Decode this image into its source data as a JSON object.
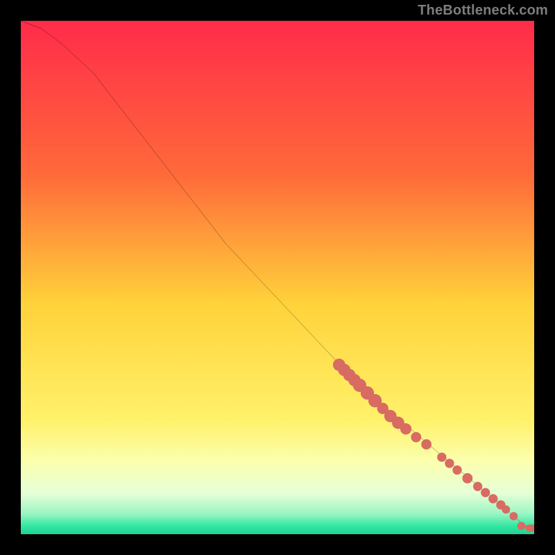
{
  "attribution": "TheBottleneck.com",
  "chart_data": {
    "type": "line",
    "title": "",
    "xlabel": "",
    "ylabel": "",
    "xlim": [
      0,
      100
    ],
    "ylim": [
      0,
      100
    ],
    "background_gradient_stops": [
      {
        "offset": 0.0,
        "color": "#ff2b4a"
      },
      {
        "offset": 0.3,
        "color": "#ff6a3a"
      },
      {
        "offset": 0.55,
        "color": "#ffd23a"
      },
      {
        "offset": 0.78,
        "color": "#fff26b"
      },
      {
        "offset": 0.86,
        "color": "#fbffb0"
      },
      {
        "offset": 0.92,
        "color": "#e6ffd6"
      },
      {
        "offset": 0.96,
        "color": "#9bf5c3"
      },
      {
        "offset": 0.985,
        "color": "#2fe6a1"
      },
      {
        "offset": 1.0,
        "color": "#1fd393"
      }
    ],
    "series": [
      {
        "name": "curve",
        "x": [
          0,
          4,
          8,
          14,
          40,
          65,
          80,
          92,
          96,
          98,
          99.2,
          100
        ],
        "y": [
          100,
          98.5,
          95.5,
          90,
          56.5,
          30,
          17,
          7,
          3.5,
          1.8,
          1.2,
          1.2
        ]
      }
    ],
    "markers": {
      "name": "highlighted-points",
      "color": "#d86b62",
      "points": [
        {
          "x": 62,
          "y": 33,
          "r": 1.2
        },
        {
          "x": 63,
          "y": 32,
          "r": 1.2
        },
        {
          "x": 64,
          "y": 31,
          "r": 1.2
        },
        {
          "x": 65,
          "y": 30,
          "r": 1.2
        },
        {
          "x": 66,
          "y": 29,
          "r": 1.3
        },
        {
          "x": 67.5,
          "y": 27.5,
          "r": 1.3
        },
        {
          "x": 69,
          "y": 26,
          "r": 1.3
        },
        {
          "x": 70.5,
          "y": 24.5,
          "r": 1.1
        },
        {
          "x": 72,
          "y": 23,
          "r": 1.2
        },
        {
          "x": 73.5,
          "y": 21.7,
          "r": 1.2
        },
        {
          "x": 75,
          "y": 20.5,
          "r": 1.1
        },
        {
          "x": 77,
          "y": 18.9,
          "r": 1.0
        },
        {
          "x": 79,
          "y": 17.5,
          "r": 1.0
        },
        {
          "x": 82,
          "y": 15,
          "r": 0.9
        },
        {
          "x": 83.5,
          "y": 13.8,
          "r": 0.9
        },
        {
          "x": 85,
          "y": 12.5,
          "r": 0.9
        },
        {
          "x": 87,
          "y": 10.9,
          "r": 1.0
        },
        {
          "x": 89,
          "y": 9.3,
          "r": 0.9
        },
        {
          "x": 90.5,
          "y": 8.1,
          "r": 0.9
        },
        {
          "x": 92,
          "y": 6.9,
          "r": 0.9
        },
        {
          "x": 93.5,
          "y": 5.7,
          "r": 0.9
        },
        {
          "x": 94.5,
          "y": 4.8,
          "r": 0.8
        },
        {
          "x": 96,
          "y": 3.5,
          "r": 0.8
        },
        {
          "x": 97.5,
          "y": 1.6,
          "r": 0.8
        },
        {
          "x": 99.0,
          "y": 1.2,
          "r": 0.7
        },
        {
          "x": 99.6,
          "y": 1.2,
          "r": 0.7
        }
      ]
    }
  }
}
